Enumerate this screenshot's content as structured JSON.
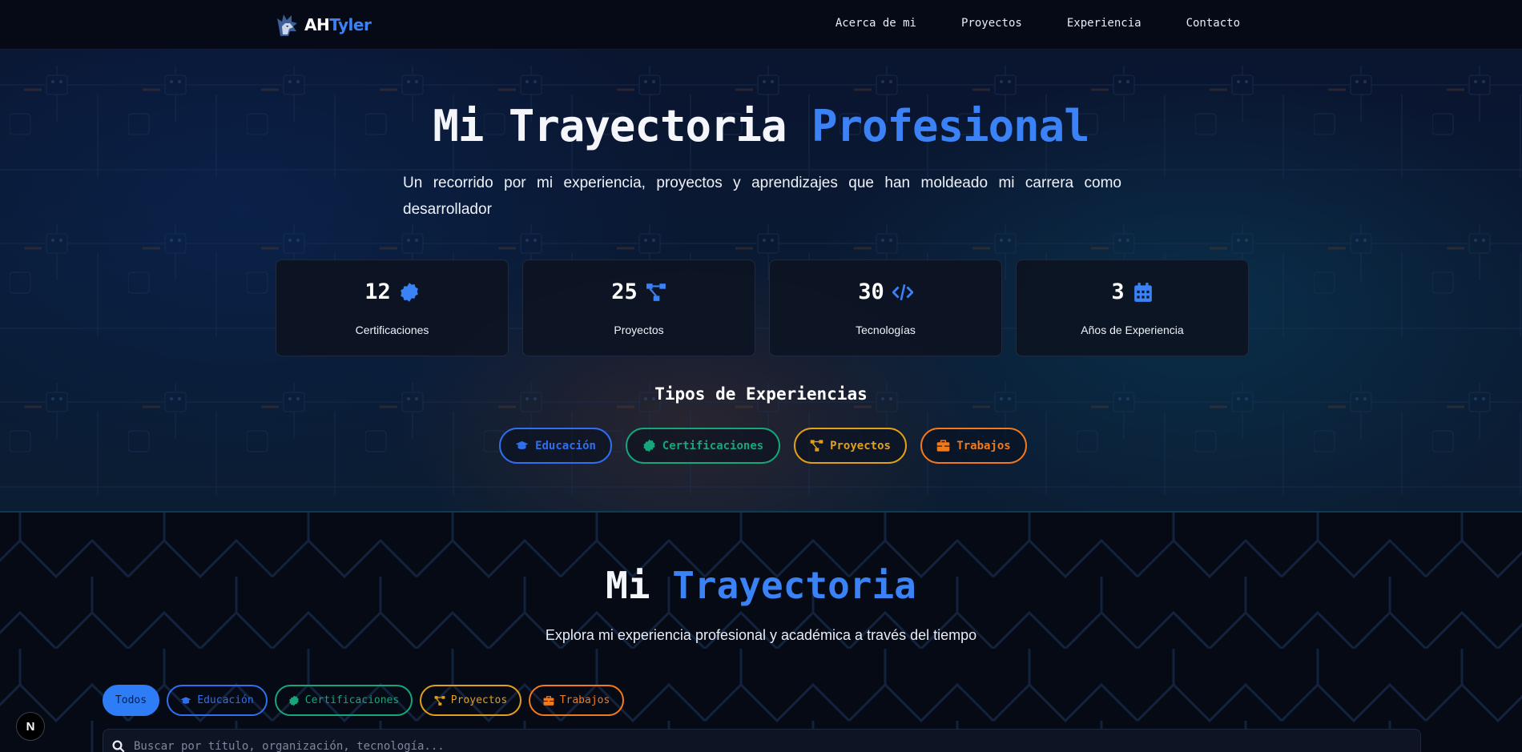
{
  "brand": {
    "name_a": "AH",
    "name_b": "Tyler"
  },
  "nav": {
    "items": [
      "Acerca de mi",
      "Proyectos",
      "Experiencia",
      "Contacto"
    ]
  },
  "hero": {
    "title_a": "Mi Trayectoria ",
    "title_b": "Profesional",
    "subtitle": "Un recorrido por mi experiencia, proyectos y aprendizajes que han moldeado mi carrera como desarrollador",
    "stats": [
      {
        "value": "12",
        "label": "Certificaciones",
        "icon": "badge-icon"
      },
      {
        "value": "25",
        "label": "Proyectos",
        "icon": "project-diagram-icon"
      },
      {
        "value": "30",
        "label": "Tecnologías",
        "icon": "code-icon"
      },
      {
        "value": "3",
        "label": "Años de Experiencia",
        "icon": "calendar-icon"
      }
    ],
    "types_title": "Tipos de Experiencias",
    "types": [
      {
        "label": "Educación",
        "icon": "graduation-cap-icon",
        "color": "#2f6ff0"
      },
      {
        "label": "Certificaciones",
        "icon": "badge-icon",
        "color": "#16a67a"
      },
      {
        "label": "Proyectos",
        "icon": "project-diagram-icon",
        "color": "#e0a019"
      },
      {
        "label": "Trabajos",
        "icon": "briefcase-icon",
        "color": "#f07a1c"
      }
    ]
  },
  "timeline": {
    "title_a": "Mi ",
    "title_b": "Trayectoria",
    "subtitle": "Explora mi experiencia profesional y académica a través del tiempo",
    "filters": [
      {
        "label": "Todos",
        "active": true,
        "color": "#2f7df6"
      },
      {
        "label": "Educación",
        "icon": "graduation-cap-icon",
        "color": "#2f6ff0"
      },
      {
        "label": "Certificaciones",
        "icon": "badge-icon",
        "color": "#16a67a"
      },
      {
        "label": "Proyectos",
        "icon": "project-diagram-icon",
        "color": "#e0a019"
      },
      {
        "label": "Trabajos",
        "icon": "briefcase-icon",
        "color": "#f07a1c"
      }
    ],
    "search_placeholder": "Buscar por título, organización, tecnología..."
  },
  "badge": {
    "letter": "N"
  }
}
